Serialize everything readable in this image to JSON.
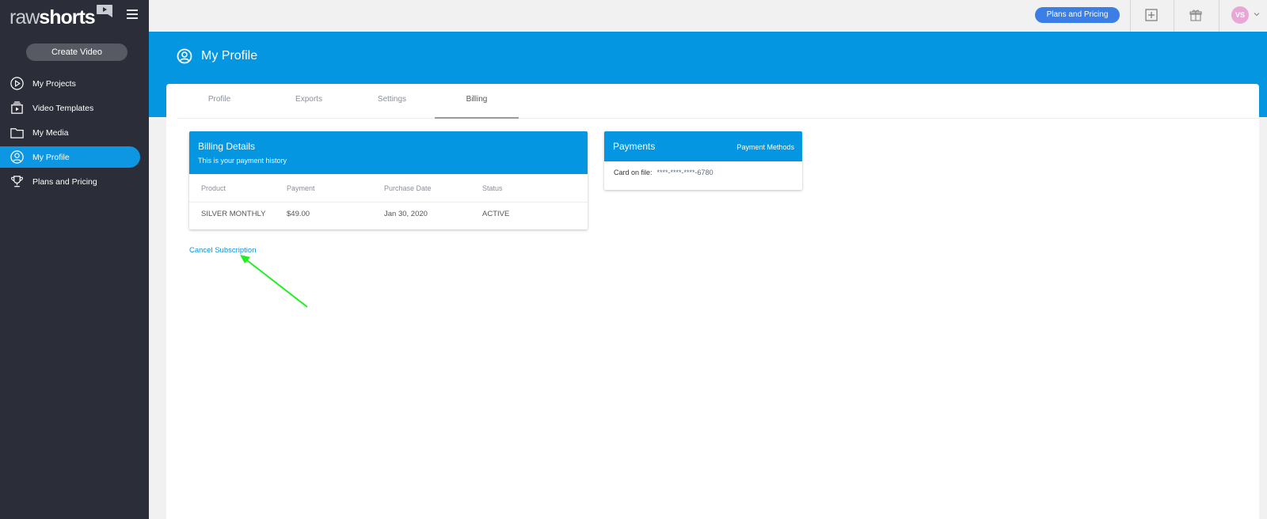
{
  "brand": {
    "logo_raw": "raw",
    "logo_shorts": "shorts"
  },
  "sidebar": {
    "create_label": "Create Video",
    "items": [
      {
        "label": "My Projects",
        "icon": "play-circle-icon"
      },
      {
        "label": "Video Templates",
        "icon": "templates-icon"
      },
      {
        "label": "My Media",
        "icon": "folder-icon"
      },
      {
        "label": "My Profile",
        "icon": "user-circle-icon",
        "active": true
      },
      {
        "label": "Plans and Pricing",
        "icon": "trophy-icon"
      }
    ]
  },
  "topbar": {
    "plans_label": "Plans and Pricing",
    "avatar_initials": "VS",
    "avatar_color": "#e8a7d6"
  },
  "header": {
    "title": "My Profile"
  },
  "tabs": [
    {
      "label": "Profile"
    },
    {
      "label": "Exports"
    },
    {
      "label": "Settings"
    },
    {
      "label": "Billing",
      "active": true
    }
  ],
  "billing": {
    "title": "Billing Details",
    "subtitle": "This is your payment history",
    "columns": [
      "Product",
      "Payment",
      "Purchase Date",
      "Status"
    ],
    "rows": [
      [
        "SILVER MONTHLY",
        "$49.00",
        "Jan 30, 2020",
        "ACTIVE"
      ]
    ]
  },
  "payments": {
    "title": "Payments",
    "methods_label": "Payment Methods",
    "card_label": "Card on file:",
    "card_number": "****-****-****-6780"
  },
  "cancel_label": "Cancel Subscription",
  "colors": {
    "accent": "#0596e2",
    "sidebar_bg": "#2b2e38",
    "plans_button": "#3b7ee6",
    "annotation_arrow": "#22ee22"
  }
}
